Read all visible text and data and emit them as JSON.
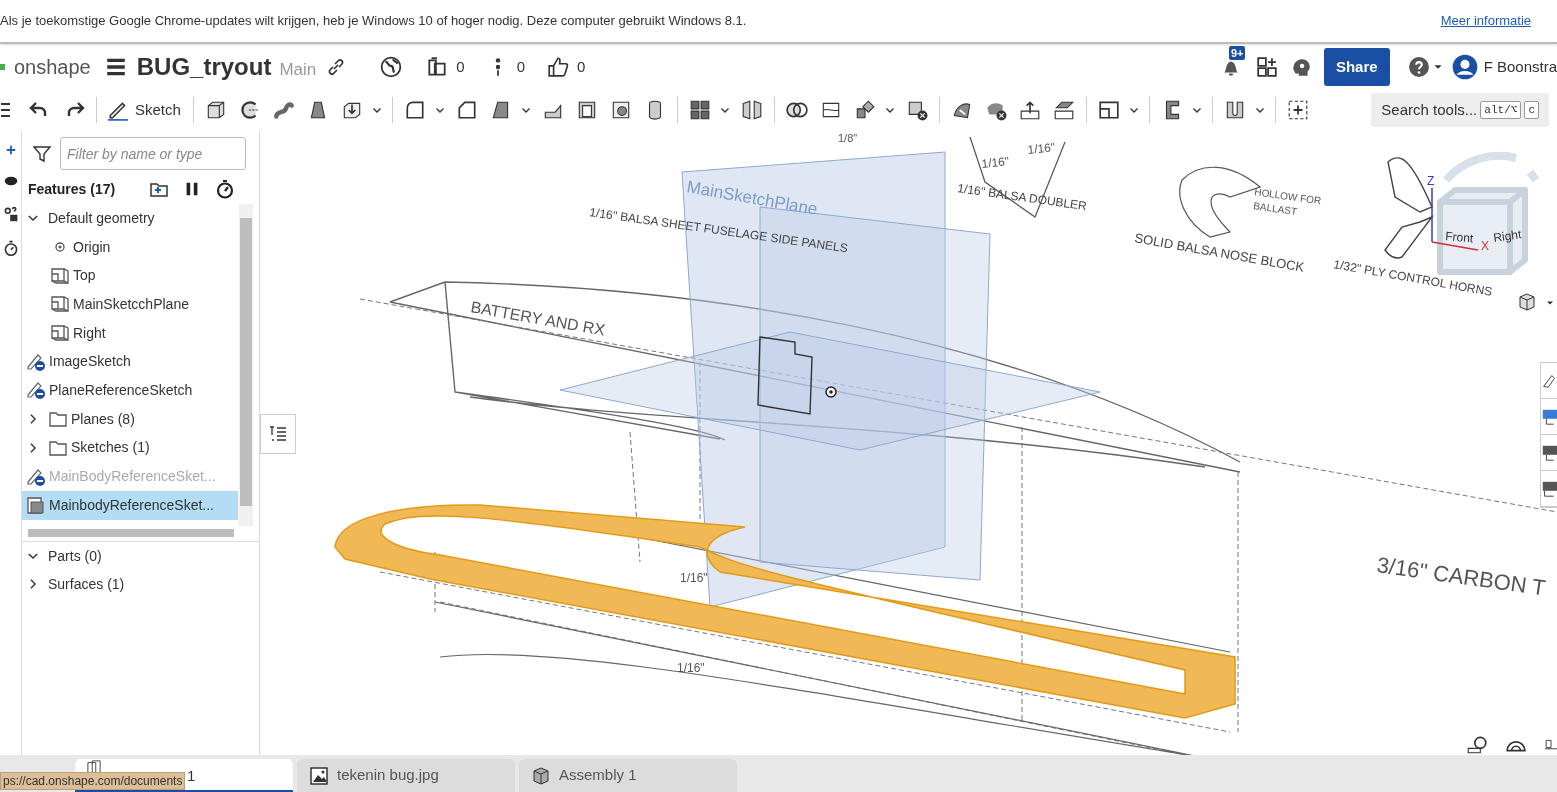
{
  "banner": {
    "message": "Als je toekomstige Google Chrome-updates wilt krijgen, heb je Windows 10 of hoger nodig. Deze computer gebruikt Windows 8.1.",
    "link": "Meer informatie"
  },
  "header": {
    "logo": "onshape",
    "title": "BUG_tryout",
    "branch": "Main",
    "counters": [
      {
        "kind": "versions",
        "value": "0"
      },
      {
        "kind": "branches",
        "value": "0"
      },
      {
        "kind": "likes",
        "value": "0"
      }
    ],
    "notifications": "9+",
    "share": "Share",
    "user": "F Boonstra"
  },
  "toolbar": {
    "sketch": "Sketch",
    "search": {
      "placeholder": "Search tools...",
      "shortcut": [
        "alt/⌥",
        "c"
      ]
    }
  },
  "features": {
    "filter": {
      "placeholder": "Filter by name or type"
    },
    "title": "Features (17)",
    "tree": [
      {
        "kind": "group",
        "label": "Default geometry",
        "expanded": true,
        "selected": false,
        "hidden": false,
        "children": [
          {
            "kind": "point",
            "label": "Origin",
            "selected": false,
            "hidden": false
          },
          {
            "kind": "plane",
            "label": "Top",
            "selected": false,
            "hidden": false
          },
          {
            "kind": "plane",
            "label": "MainSketcchPlane",
            "selected": false,
            "hidden": false
          },
          {
            "kind": "plane",
            "label": "Right",
            "selected": false,
            "hidden": false
          }
        ]
      },
      {
        "kind": "sketch",
        "label": "ImageSketch",
        "selected": false,
        "hidden": false
      },
      {
        "kind": "sketch",
        "label": "PlaneReferenceSketch",
        "selected": false,
        "hidden": false
      },
      {
        "kind": "folder",
        "label": "Planes (8)",
        "expanded": false,
        "selected": false,
        "hidden": false
      },
      {
        "kind": "folder",
        "label": "Sketches (1)",
        "expanded": false,
        "selected": false,
        "hidden": false
      },
      {
        "kind": "sketch",
        "label": "MainBodyReferenceSket...",
        "selected": false,
        "hidden": true
      },
      {
        "kind": "extrude",
        "label": "MainbodyReferenceSket...",
        "selected": true,
        "hidden": false
      }
    ]
  },
  "sections": [
    {
      "label": "Parts (0)",
      "expanded": true
    },
    {
      "label": "Surfaces (1)",
      "expanded": false
    }
  ],
  "viewport": {
    "labels": [
      "1/8\"",
      "1/16\"",
      "1/16\"",
      "1/16\" BALSA DOUBLER",
      "HOLLOW FOR",
      "BALLAST",
      "SOLID BALSA NOSE BLOCK",
      "1/32\" PLY CONTROL HORNS",
      "1/16\" BALSA SHEET FUSELAGE SIDE PANELS",
      "MainSketchPlane",
      "BATTERY AND RX",
      "1/16\"",
      "1/16\"",
      "3/16\" CARBON T"
    ],
    "view_cube": {
      "faces": [
        "Front",
        "Right"
      ],
      "axes": [
        "Z",
        "X"
      ]
    }
  },
  "tabs": [
    {
      "kind": "partstudio",
      "label": "1",
      "selected": true
    },
    {
      "kind": "image",
      "label": "tekenin bug.jpg",
      "selected": false
    },
    {
      "kind": "assembly",
      "label": "Assembly 1",
      "selected": false
    }
  ],
  "status_url": "ps://cad.onshape.com/documents"
}
